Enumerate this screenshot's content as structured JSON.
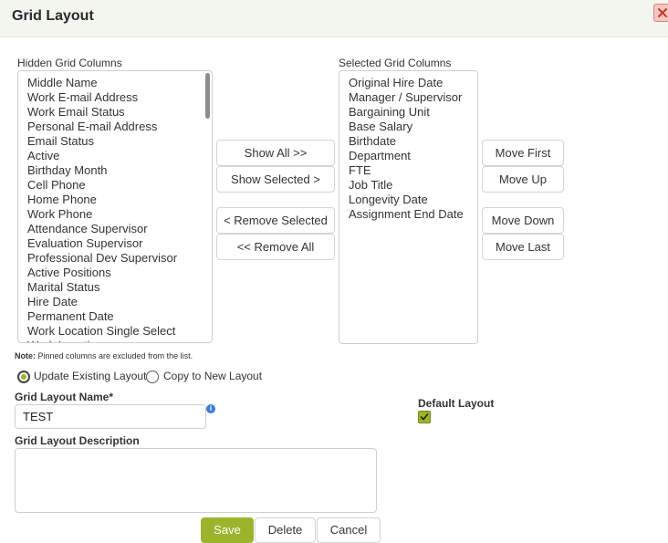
{
  "window": {
    "title": "Grid Layout",
    "close_icon": "close-icon"
  },
  "hidden_columns": {
    "label": "Hidden Grid Columns",
    "items": [
      "Middle Name",
      "Work E-mail Address",
      "Work Email Status",
      "Personal E-mail Address",
      "Email Status",
      "Active",
      "Birthday Month",
      "Cell Phone",
      "Home Phone",
      "Work Phone",
      "Attendance Supervisor",
      "Evaluation Supervisor",
      "Professional Dev Supervisor",
      "Active Positions",
      "Marital Status",
      "Hire Date",
      "Permanent Date",
      "Work Location Single Select",
      "Work Location"
    ]
  },
  "selected_columns": {
    "label": "Selected Grid Columns",
    "items": [
      "Original Hire Date",
      "Manager / Supervisor",
      "Bargaining Unit",
      "Base Salary",
      "Birthdate",
      "Department",
      "FTE",
      "Job Title",
      "Longevity Date",
      "Assignment End Date"
    ]
  },
  "transfer_buttons": {
    "show_all": "Show All >>",
    "show_selected": "Show Selected >",
    "remove_selected": "< Remove Selected",
    "remove_all": "<< Remove All"
  },
  "order_buttons": {
    "move_first": "Move First",
    "move_up": "Move Up",
    "move_down": "Move Down",
    "move_last": "Move Last"
  },
  "note": {
    "prefix": "Note:",
    "text": " Pinned columns are excluded from the list."
  },
  "save_mode": {
    "options": [
      "Update Existing Layout",
      "Copy to New Layout"
    ],
    "selected": "Update Existing Layout"
  },
  "layout_name": {
    "label": "Grid Layout Name*",
    "value": "TEST",
    "info_icon": "info-icon"
  },
  "layout_description": {
    "label": "Grid Layout Description",
    "value": ""
  },
  "default_layout": {
    "label": "Default Layout",
    "checked": true
  },
  "footer": {
    "save": "Save",
    "delete": "Delete",
    "cancel": "Cancel"
  },
  "colors": {
    "accent": "#9ab52c",
    "header_bg": "#f3f5ef",
    "close_bg": "#f4c6c2",
    "info": "#3b7bd6"
  }
}
